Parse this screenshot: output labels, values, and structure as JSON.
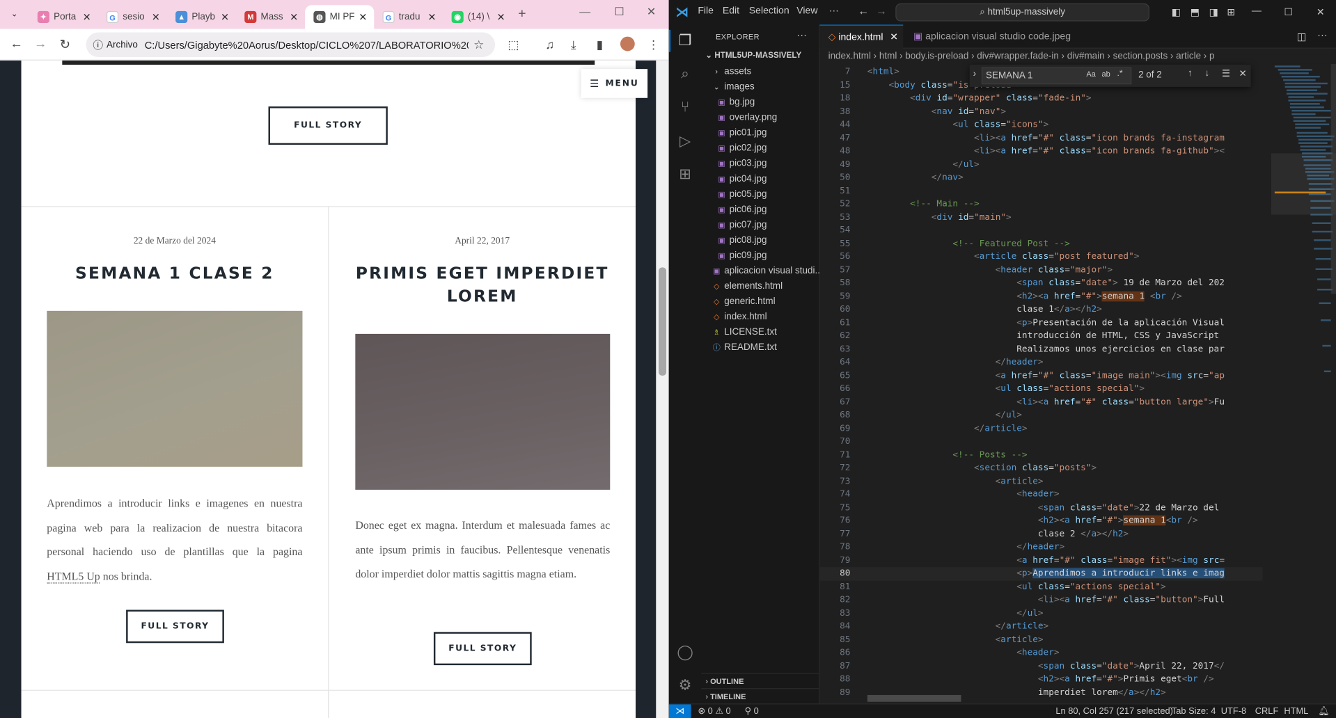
{
  "browser": {
    "tabs": [
      {
        "title": "Porta",
        "icon": "portfolio-favicon"
      },
      {
        "title": "sesio",
        "icon": "google-favicon"
      },
      {
        "title": "Playb",
        "icon": "image-favicon"
      },
      {
        "title": "Mass",
        "icon": "html5up-favicon"
      },
      {
        "title": "MI PF",
        "icon": "globe-favicon",
        "active": true
      },
      {
        "title": "tradu",
        "icon": "google-favicon"
      },
      {
        "title": "(14) \\",
        "icon": "whatsapp-favicon"
      }
    ],
    "chip": "Archivo",
    "url": "C:/Users/Gigabyte%20Aorus/Desktop/CICLO%207/LABORATORIO%202/h...",
    "menu_label": "MENU",
    "top_button": "FULL STORY",
    "posts": [
      {
        "date": "22 de Marzo del 2024",
        "title": "SEMANA 1 CLASE 2",
        "text_before": "Aprendimos a introducir links e imagenes en nuestra pagina web para la realizacion de nuestra bitacora personal haciendo uso de plantillas que la pagina ",
        "text_link": "HTML5 Up",
        "text_after": " nos brinda.",
        "button": "FULL STORY"
      },
      {
        "date": "April 22, 2017",
        "title": "PRIMIS EGET IMPERDIET LOREM",
        "text": "Donec eget ex magna. Interdum et malesuada fames ac ante ipsum primis in faucibus. Pellentesque venenatis dolor imperdiet dolor mattis sagittis magna etiam.",
        "button": "FULL STORY"
      }
    ]
  },
  "vscode": {
    "menu": [
      "File",
      "Edit",
      "Selection",
      "View",
      "···"
    ],
    "search": "html5up-massively",
    "explorer_title": "EXPLORER",
    "project": "HTML5UP-MASSIVELY",
    "tree": [
      {
        "label": "assets",
        "kind": "folder",
        "depth": 1,
        "open": false
      },
      {
        "label": "images",
        "kind": "folder",
        "depth": 1,
        "open": true
      },
      {
        "label": "bg.jpg",
        "kind": "img",
        "depth": 2
      },
      {
        "label": "overlay.png",
        "kind": "img",
        "depth": 2
      },
      {
        "label": "pic01.jpg",
        "kind": "img",
        "depth": 2
      },
      {
        "label": "pic02.jpg",
        "kind": "img",
        "depth": 2
      },
      {
        "label": "pic03.jpg",
        "kind": "img",
        "depth": 2
      },
      {
        "label": "pic04.jpg",
        "kind": "img",
        "depth": 2
      },
      {
        "label": "pic05.jpg",
        "kind": "img",
        "depth": 2
      },
      {
        "label": "pic06.jpg",
        "kind": "img",
        "depth": 2
      },
      {
        "label": "pic07.jpg",
        "kind": "img",
        "depth": 2
      },
      {
        "label": "pic08.jpg",
        "kind": "img",
        "depth": 2
      },
      {
        "label": "pic09.jpg",
        "kind": "img",
        "depth": 2
      },
      {
        "label": "aplicacion visual studi...",
        "kind": "img",
        "depth": 1
      },
      {
        "label": "elements.html",
        "kind": "html",
        "depth": 1
      },
      {
        "label": "generic.html",
        "kind": "html",
        "depth": 1
      },
      {
        "label": "index.html",
        "kind": "html",
        "depth": 1
      },
      {
        "label": "LICENSE.txt",
        "kind": "lic",
        "depth": 1
      },
      {
        "label": "README.txt",
        "kind": "info",
        "depth": 1
      }
    ],
    "outline": "OUTLINE",
    "timeline": "TIMELINE",
    "tabs": [
      {
        "label": "index.html",
        "active": true
      },
      {
        "label": "aplicacion visual studio code.jpeg",
        "active": false
      }
    ],
    "breadcrumbs": "index.html  ›  html  ›  body.is-preload  ›  div#wrapper.fade-in  ›  div#main  ›  section.posts  ›  article  ›  p",
    "find": {
      "query": "SEMANA 1",
      "result": "2 of 2"
    },
    "status": {
      "errors": "⊗ 0 ⚠ 0",
      "ports": "⚲ 0",
      "position": "Ln 80, Col 257 (217 selected)",
      "tab": "Tab Size: 4",
      "enc": "UTF-8",
      "eol": "CRLF",
      "lang": "HTML"
    }
  }
}
